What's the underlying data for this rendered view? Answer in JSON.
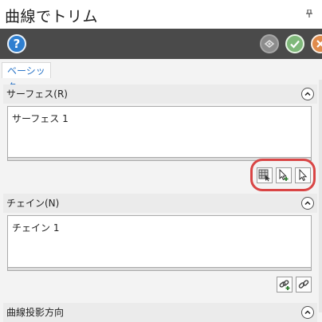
{
  "window": {
    "title": "曲線でトリム",
    "pin_glyph": "ᵖ"
  },
  "toolbar": {
    "help_icon": "help-icon",
    "help_glyph": "?",
    "preview_icon": "preview-icon",
    "ok_icon": "check-icon",
    "cancel_icon": "close-icon"
  },
  "tabs": [
    {
      "label": "ベーシック",
      "active": true
    }
  ],
  "sections": [
    {
      "title": "サーフェス(R)",
      "items": [
        "サーフェス 1"
      ],
      "buttons": [
        "select-grid-icon",
        "add-select-icon",
        "select-pointer-icon"
      ]
    },
    {
      "title": "チェイン(N)",
      "items": [
        "チェイン 1"
      ],
      "buttons": [
        "add-chain-icon",
        "chain-link-icon"
      ]
    },
    {
      "title": "曲線投影方向"
    }
  ],
  "colors": {
    "toolbar": "#4a4a4a",
    "tab_text": "#2d76c7",
    "highlight": "#d94545"
  }
}
